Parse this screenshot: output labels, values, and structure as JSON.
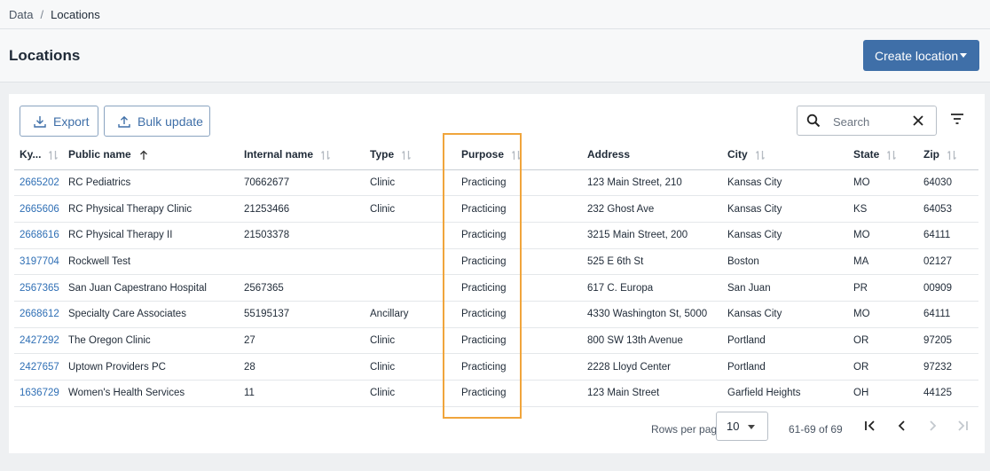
{
  "breadcrumb": {
    "root": "Data",
    "separator": "/",
    "current": "Locations"
  },
  "header": {
    "title": "Locations",
    "create_label": "Create location"
  },
  "toolbar": {
    "export_label": "Export",
    "bulk_update_label": "Bulk update"
  },
  "search": {
    "placeholder": "Search",
    "value": ""
  },
  "table": {
    "columns": [
      "Ky...",
      "Public name",
      "Internal name",
      "Type",
      "Purpose",
      "Address",
      "City",
      "State",
      "Zip"
    ],
    "rows": [
      [
        "2665202",
        "RC Pediatrics",
        "70662677",
        "Clinic",
        "Practicing",
        "123 Main Street, 210",
        "Kansas City",
        "MO",
        "64030"
      ],
      [
        "2665606",
        "RC Physical Therapy Clinic",
        "21253466",
        "Clinic",
        "Practicing",
        "232 Ghost Ave",
        "Kansas City",
        "KS",
        "64053"
      ],
      [
        "2668616",
        "RC Physical Therapy II",
        "21503378",
        "",
        "Practicing",
        "3215 Main Street, 200",
        "Kansas City",
        "MO",
        "64111"
      ],
      [
        "3197704",
        "Rockwell Test",
        "",
        "",
        "Practicing",
        "525 E 6th St",
        "Boston",
        "MA",
        "02127"
      ],
      [
        "2567365",
        "San Juan Capestrano Hospital",
        "2567365",
        "",
        "Practicing",
        "617 C. Europa",
        "San Juan",
        "PR",
        "00909"
      ],
      [
        "2668612",
        "Specialty Care Associates",
        "55195137",
        "Ancillary",
        "Practicing",
        "4330 Washington St, 5000",
        "Kansas City",
        "MO",
        "64111"
      ],
      [
        "2427292",
        "The Oregon Clinic",
        "27",
        "Clinic",
        "Practicing",
        "800 SW 13th Avenue",
        "Portland",
        "OR",
        "97205"
      ],
      [
        "2427657",
        "Uptown Providers PC",
        "28",
        "Clinic",
        "Practicing",
        "2228 Lloyd Center",
        "Portland",
        "OR",
        "97232"
      ],
      [
        "1636729",
        "Women's Health Services",
        "11",
        "Clinic",
        "Practicing",
        "123 Main Street",
        "Garfield Heights",
        "OH",
        "44125"
      ]
    ]
  },
  "pagination": {
    "rows_per_page_label": "Rows per page",
    "rows_per_page": "10",
    "range": "61-69 of 69"
  },
  "colors": {
    "accent": "#3f6fa8",
    "link": "#2f6fb5",
    "highlight": "#f0a53c"
  }
}
